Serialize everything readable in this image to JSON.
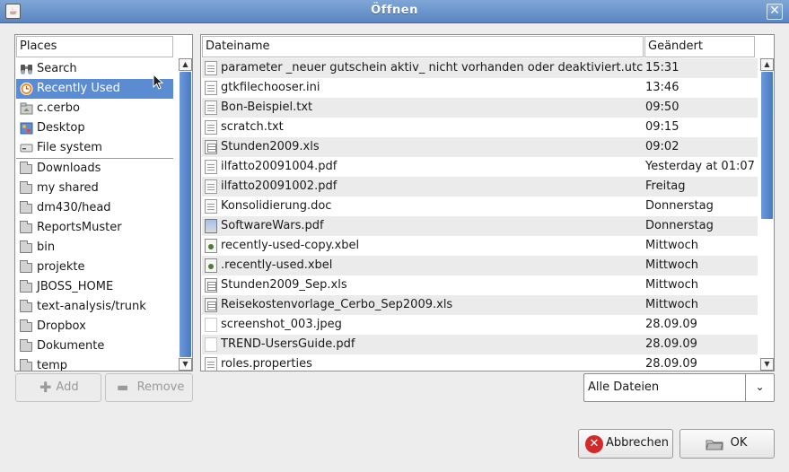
{
  "window": {
    "title": "Öffnen",
    "close_glyph": "✕",
    "app_icon": "java-cup-icon"
  },
  "places": {
    "header": "Places",
    "items": [
      {
        "label": "Search",
        "icon": "search-icon"
      },
      {
        "label": "Recently Used",
        "icon": "recent-icon",
        "selected": true
      },
      {
        "label": "c.cerbo",
        "icon": "home-icon"
      },
      {
        "label": "Desktop",
        "icon": "desktop-icon"
      },
      {
        "label": "File system",
        "icon": "drive-icon"
      }
    ],
    "bookmarks": [
      "Downloads",
      "my shared",
      "dm430/head",
      "ReportsMuster",
      "bin",
      "projekte",
      "JBOSS_HOME",
      "text-analysis/trunk",
      "Dropbox",
      "Dokumente",
      "temp"
    ]
  },
  "places_buttons": {
    "add": "Add",
    "remove": "Remove"
  },
  "files": {
    "header_name": "Dateiname",
    "header_modified": "Geändert",
    "rows": [
      {
        "name": "parameter _neuer gutschein aktiv_ nicht vorhanden oder deaktiviert.utc",
        "modified": "15:31",
        "icon": "doc"
      },
      {
        "name": "gtkfilechooser.ini",
        "modified": "13:46",
        "icon": "doc"
      },
      {
        "name": "Bon-Beispiel.txt",
        "modified": "09:50",
        "icon": "doc"
      },
      {
        "name": "scratch.txt",
        "modified": "09:15",
        "icon": "doc"
      },
      {
        "name": "Stunden2009.xls",
        "modified": "09:02",
        "icon": "sheet"
      },
      {
        "name": "ilfatto20091004.pdf",
        "modified": "Yesterday at 01:07",
        "icon": "doc"
      },
      {
        "name": "ilfatto20091002.pdf",
        "modified": "Freitag",
        "icon": "doc"
      },
      {
        "name": "Konsolidierung.doc",
        "modified": "Donnerstag",
        "icon": "doc"
      },
      {
        "name": "SoftwareWars.pdf",
        "modified": "Donnerstag",
        "icon": "image"
      },
      {
        "name": "recently-used-copy.xbel",
        "modified": "Mittwoch",
        "icon": "xbel"
      },
      {
        "name": ".recently-used.xbel",
        "modified": "Mittwoch",
        "icon": "xbel"
      },
      {
        "name": "Stunden2009_Sep.xls",
        "modified": "Mittwoch",
        "icon": "sheet"
      },
      {
        "name": "Reisekostenvorlage_Cerbo_Sep2009.xls",
        "modified": "Mittwoch",
        "icon": "sheet"
      },
      {
        "name": "screenshot_003.jpeg",
        "modified": "28.09.09",
        "icon": "blank"
      },
      {
        "name": "TREND-UsersGuide.pdf",
        "modified": "28.09.09",
        "icon": "blank"
      },
      {
        "name": "roles.properties",
        "modified": "28.09.09",
        "icon": "doc"
      }
    ]
  },
  "filter": {
    "selected": "Alle Dateien",
    "arrow_glyph": "⌄"
  },
  "actions": {
    "cancel": "Abbrechen",
    "ok": "OK"
  },
  "colors": {
    "accent": "#5b8bd0",
    "titlebar": "#6b95cd",
    "cancel_icon": "#d22a2a"
  }
}
